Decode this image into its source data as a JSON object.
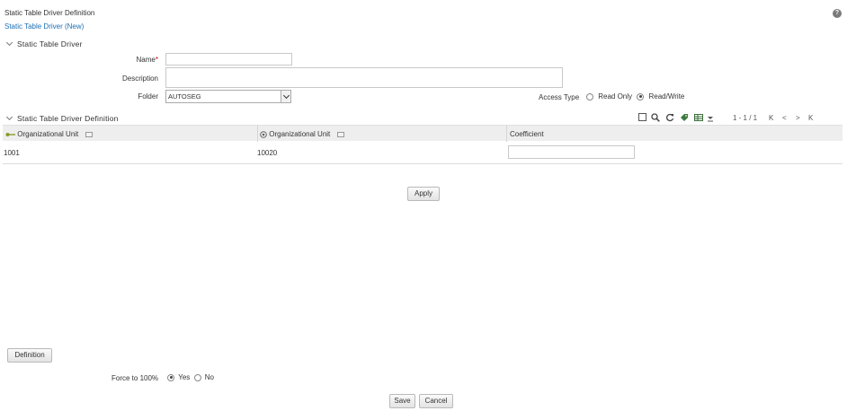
{
  "header": {
    "title": "Static Table Driver Definition",
    "subtitle": "Static Table Driver (New)",
    "help_icon": "?"
  },
  "driver_section": {
    "label": "Static Table Driver",
    "name_label": "Name",
    "name_required": "*",
    "name_value": "",
    "description_label": "Description",
    "description_value": "",
    "folder_label": "Folder",
    "folder_value": "AUTOSEG",
    "access_type_label": "Access Type",
    "access_options": [
      "Read Only",
      "Read/Write"
    ],
    "access_selected": "Read/Write"
  },
  "definition_section": {
    "label": "Static Table Driver Definition",
    "toolbar_icons": [
      "select-all-icon",
      "search-icon",
      "refresh-icon",
      "tag-icon",
      "grid-icon",
      "dropdown-icon"
    ],
    "pager": {
      "range": "1 - 1 / 1",
      "first": "K",
      "prev": "<",
      "next": ">",
      "last": "K"
    },
    "columns": [
      "Organizational Unit",
      "Organizational Unit",
      "Coefficient"
    ],
    "rows": [
      {
        "unit_1": "1001",
        "unit_2": "10020",
        "coefficient": ""
      }
    ]
  },
  "buttons": {
    "apply": "Apply",
    "definition": "Definition",
    "save": "Save",
    "cancel": "Cancel"
  },
  "force": {
    "label": "Force to 100%",
    "options": [
      "Yes",
      "No"
    ],
    "selected": "Yes"
  }
}
